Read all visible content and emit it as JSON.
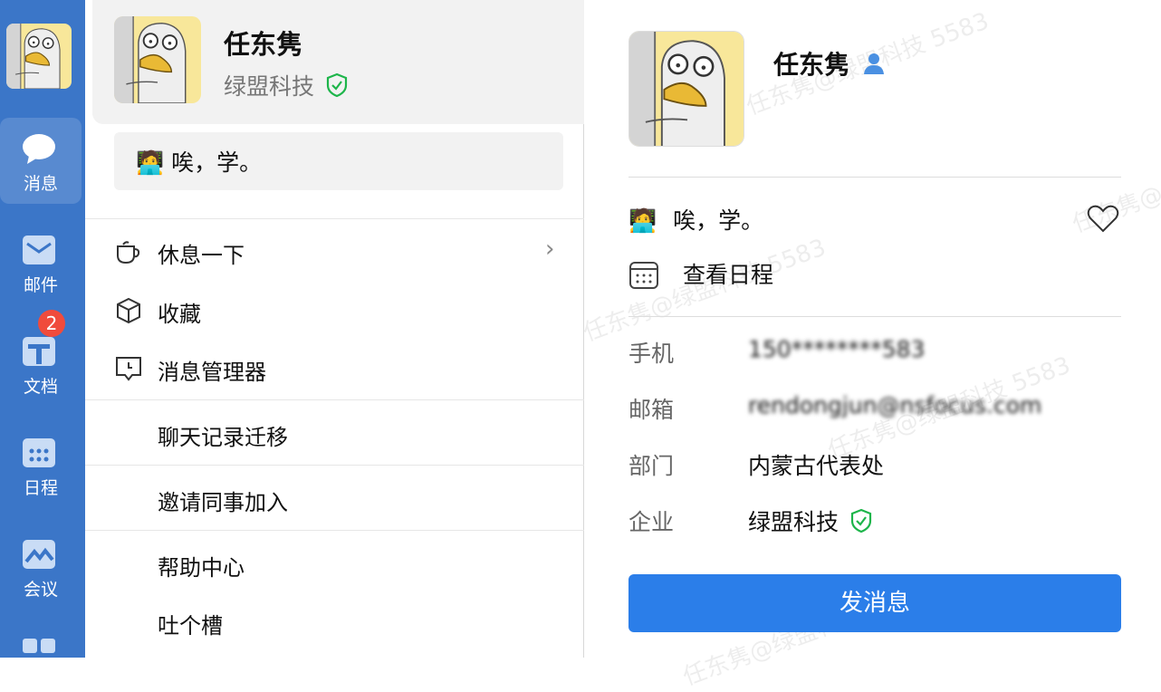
{
  "user": {
    "name": "任东隽",
    "company": "绿盟科技",
    "status_emoji": "🧑‍💻",
    "status_text": "唉，学。"
  },
  "sidebar": {
    "items": [
      {
        "label": "消息",
        "icon": "chat-bubble-icon",
        "active": true
      },
      {
        "label": "邮件",
        "icon": "mail-icon"
      },
      {
        "label": "文档",
        "icon": "document-icon",
        "badge": "2"
      },
      {
        "label": "日程",
        "icon": "calendar-icon"
      },
      {
        "label": "会议",
        "icon": "meeting-icon"
      }
    ]
  },
  "menu": {
    "items": [
      {
        "label": "休息一下",
        "icon": "coffee-cup-icon"
      },
      {
        "label": "收藏",
        "icon": "box-icon"
      },
      {
        "label": "消息管理器",
        "icon": "message-manager-icon"
      },
      {
        "label": "聊天记录迁移"
      },
      {
        "label": "邀请同事加入"
      },
      {
        "label": "帮助中心"
      },
      {
        "label": "吐个槽"
      }
    ]
  },
  "profile": {
    "view_schedule": "查看日程",
    "fields": [
      {
        "label": "手机",
        "value": "150********583"
      },
      {
        "label": "邮箱",
        "value": "rendongjun@nsfocus.com"
      },
      {
        "label": "部门",
        "value": "内蒙古代表处"
      },
      {
        "label": "企业",
        "value": "绿盟科技"
      }
    ],
    "send_button": "发消息"
  },
  "watermark": "任东隽@绿盟科技 5583",
  "colors": {
    "sidebar": "#3b76c8",
    "accent": "#2b7ee9",
    "verified": "#1db54a",
    "badge": "#f04b3c"
  }
}
